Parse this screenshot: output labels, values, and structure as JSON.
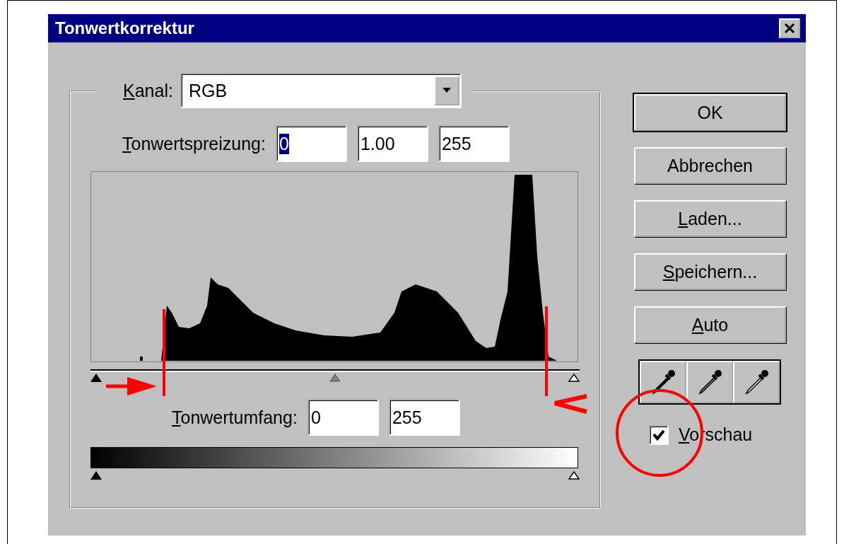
{
  "window": {
    "title": "Tonwertkorrektur"
  },
  "channel": {
    "label": "Kanal:",
    "value": "RGB"
  },
  "input_levels": {
    "label": "Tonwertspreizung:",
    "fields": [
      {
        "value": "0",
        "selected": true
      },
      {
        "value": "1.00",
        "selected": false
      },
      {
        "value": "255",
        "selected": false
      }
    ],
    "handles": [
      {
        "kind": "black",
        "level": 0
      },
      {
        "kind": "gamma",
        "level": 0.5
      },
      {
        "kind": "white",
        "level": 1
      }
    ]
  },
  "output_levels": {
    "label": "Tonwertumfang:",
    "fields": [
      {
        "value": "0"
      },
      {
        "value": "255"
      }
    ],
    "handles": [
      {
        "kind": "black",
        "level": 0
      },
      {
        "kind": "white",
        "level": 1
      }
    ]
  },
  "buttons": [
    {
      "label": "OK",
      "default": true
    },
    {
      "label": "Abbrechen",
      "default": false
    },
    {
      "label": "Laden...",
      "default": false
    },
    {
      "label": "Speichern...",
      "default": false
    },
    {
      "label": "Auto",
      "default": false
    }
  ],
  "eyedroppers": [
    {
      "kind": "black"
    },
    {
      "kind": "gray"
    },
    {
      "kind": "white"
    }
  ],
  "preview": {
    "label": "Vorschau",
    "checked": true
  }
}
